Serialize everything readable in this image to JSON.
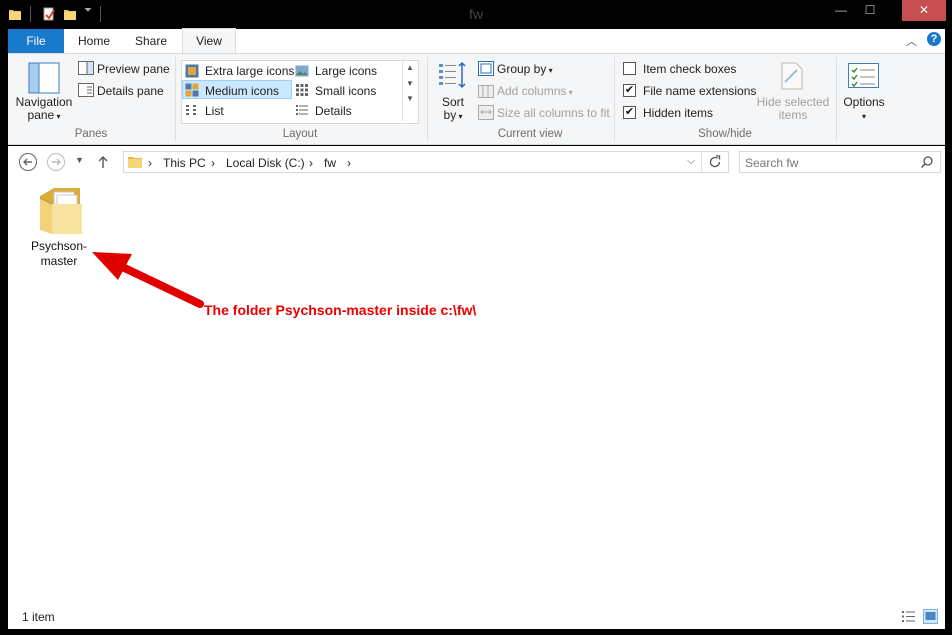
{
  "window": {
    "title": "fw",
    "minimize_glyph": "—",
    "maximize_glyph": "☐",
    "close_glyph": "✕"
  },
  "ribbon_tabs": [
    {
      "label": "File"
    },
    {
      "label": "Home"
    },
    {
      "label": "Share"
    },
    {
      "label": "View"
    }
  ],
  "ribbon": {
    "panes": {
      "navigation_pane_line1": "Navigation",
      "navigation_pane_line2": "pane",
      "preview_pane": "Preview pane",
      "details_pane": "Details pane",
      "group_label": "Panes"
    },
    "layout": {
      "extra_large_icons": "Extra large icons",
      "large_icons": "Large icons",
      "medium_icons": "Medium icons",
      "small_icons": "Small icons",
      "list": "List",
      "details": "Details",
      "group_label": "Layout",
      "selected": "Medium icons"
    },
    "current_view": {
      "sort_line1": "Sort",
      "sort_line2": "by",
      "group_by": "Group by",
      "add_columns": "Add columns",
      "size_all_columns": "Size all columns to fit",
      "group_label": "Current view"
    },
    "show_hide": {
      "item_check_boxes": "Item check boxes",
      "item_check_boxes_checked": false,
      "file_name_extensions": "File name extensions",
      "file_name_extensions_checked": true,
      "hidden_items": "Hidden items",
      "hidden_items_checked": true,
      "hide_selected_line1": "Hide selected",
      "hide_selected_line2": "items",
      "group_label": "Show/hide"
    },
    "options": {
      "label": "Options"
    },
    "check_glyph": "✔"
  },
  "address": {
    "crumbs": [
      "This PC",
      "Local Disk (C:)",
      "fw"
    ],
    "separator": "›",
    "search_placeholder": "Search fw"
  },
  "content": {
    "items": [
      {
        "name_line1": "Psychson-",
        "name_line2": "master",
        "icon": "folder-icon"
      }
    ],
    "annotation": "The folder Psychson-master inside c:\\fw\\",
    "annotation_color": "#ee0000"
  },
  "status": {
    "item_count": "1 item"
  },
  "colors": {
    "file_tab": "#1979ca",
    "close_button": "#c74e4e",
    "selection": "#cce8ff"
  }
}
